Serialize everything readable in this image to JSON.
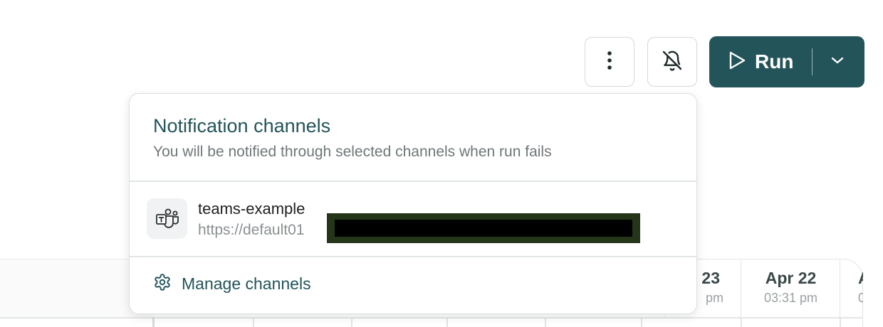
{
  "toolbar": {
    "more_icon": "more-vertical-icon",
    "bell_icon": "bell-off-icon",
    "run_icon": "play-icon",
    "run_label": "Run",
    "run_menu_icon": "chevron-down-icon",
    "accent_color": "#23545a"
  },
  "popover": {
    "title": "Notification channels",
    "subtitle": "You will be notified through selected channels when run fails",
    "channels": [
      {
        "icon": "microsoft-teams-icon",
        "name": "teams-example",
        "url": "https://default01"
      }
    ],
    "manage_icon": "gear-icon",
    "manage_label": "Manage channels"
  },
  "background_table": {
    "columns": [
      {
        "date": "23",
        "time": "pm"
      },
      {
        "date": "Apr 22",
        "time": "03:31 pm"
      },
      {
        "date": "A",
        "time": "0"
      }
    ]
  }
}
